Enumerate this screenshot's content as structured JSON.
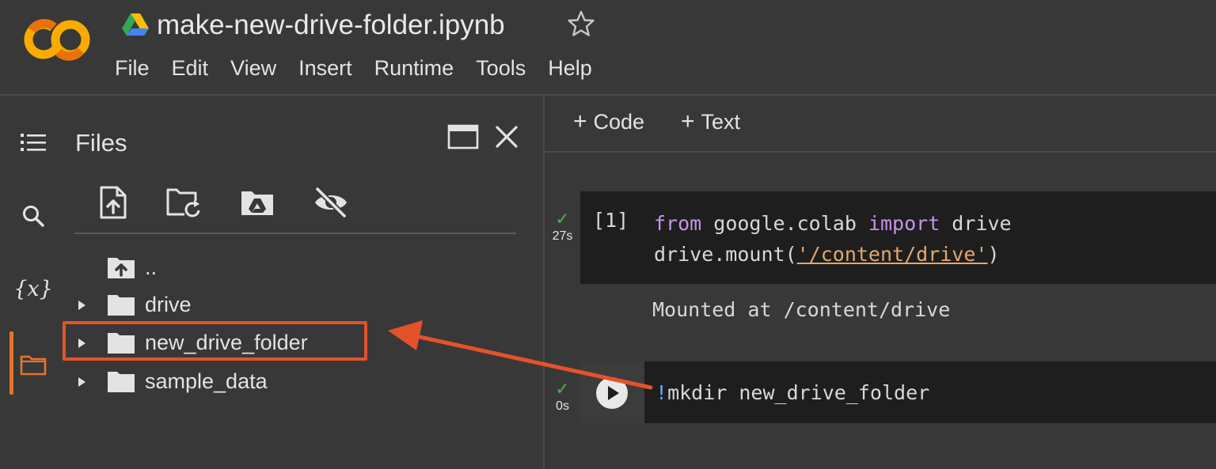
{
  "header": {
    "notebook_title": "make-new-drive-folder.ipynb",
    "menu": [
      "File",
      "Edit",
      "View",
      "Insert",
      "Runtime",
      "Tools",
      "Help"
    ],
    "logo_colors": {
      "primary": "#f9ab00",
      "secondary": "#e8710a"
    }
  },
  "rail": {
    "items": [
      {
        "name": "table-of-contents",
        "icon": "list-icon"
      },
      {
        "name": "find-replace",
        "icon": "search-icon"
      },
      {
        "name": "variables",
        "icon": "variables-icon",
        "glyph": "{x}"
      },
      {
        "name": "files",
        "icon": "folder-icon",
        "active": true
      }
    ],
    "active_color": "#e8742c"
  },
  "files_panel": {
    "title": "Files",
    "toolbar": [
      {
        "name": "upload-file",
        "icon": "upload-file-icon"
      },
      {
        "name": "refresh",
        "icon": "folder-refresh-icon"
      },
      {
        "name": "mount-drive",
        "icon": "drive-folder-icon"
      },
      {
        "name": "toggle-hidden",
        "icon": "eye-off-icon"
      }
    ],
    "tree": [
      {
        "name": "..",
        "type": "parent"
      },
      {
        "name": "drive",
        "type": "folder"
      },
      {
        "name": "new_drive_folder",
        "type": "folder",
        "highlighted": true
      },
      {
        "name": "sample_data",
        "type": "folder"
      }
    ],
    "highlight_color": "#e4522c"
  },
  "notebook": {
    "add_code_label": "Code",
    "add_text_label": "Text",
    "cells": [
      {
        "exec_count": "[1]",
        "status": "✓",
        "exec_time": "27s",
        "code_lines": [
          [
            {
              "t": "from",
              "c": "kw"
            },
            {
              "t": " google.colab "
            },
            {
              "t": "import",
              "c": "kw"
            },
            {
              "t": " drive"
            }
          ],
          [
            {
              "t": "drive.mount("
            },
            {
              "t": "'/content/drive'",
              "c": "str"
            },
            {
              "t": ")"
            }
          ]
        ],
        "output": "Mounted at /content/drive"
      },
      {
        "exec_count": "",
        "status": "✓",
        "exec_time": "0s",
        "code_lines": [
          [
            {
              "t": "!",
              "c": "bang"
            },
            {
              "t": "mkdir new_drive_folder"
            }
          ]
        ]
      }
    ],
    "syntax_colors": {
      "keyword": "#c792ea",
      "string": "#e3a86f",
      "shell": "#6aa8ff"
    }
  }
}
